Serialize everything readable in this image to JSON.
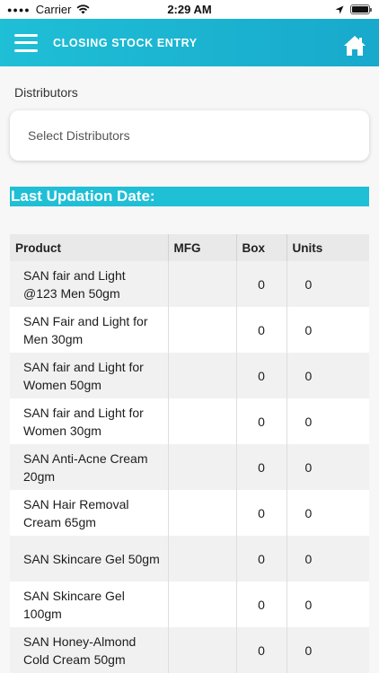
{
  "status_bar": {
    "carrier": "Carrier",
    "time": "2:29 AM",
    "icons": [
      "wifi-icon",
      "location-arrow-icon",
      "battery-icon"
    ]
  },
  "header": {
    "title": "CLOSING STOCK ENTRY",
    "menu_icon": "hamburger-menu-icon",
    "home_icon": "home-icon",
    "accent_color": "#1fbfd6"
  },
  "distributors": {
    "label": "Distributors",
    "placeholder": "Select Distributors"
  },
  "last_updation": {
    "label": "Last Updation Date:"
  },
  "table": {
    "columns": [
      "Product",
      "MFG",
      "Box",
      "Units"
    ],
    "rows": [
      {
        "product": "SAN fair and Light @123 Men 50gm",
        "mfg": "",
        "box": "0",
        "units": "0"
      },
      {
        "product": "SAN Fair and Light for Men 30gm",
        "mfg": "",
        "box": "0",
        "units": "0"
      },
      {
        "product": "SAN fair and Light for Women 50gm",
        "mfg": "",
        "box": "0",
        "units": "0"
      },
      {
        "product": "SAN fair and Light for Women 30gm",
        "mfg": "",
        "box": "0",
        "units": "0"
      },
      {
        "product": "SAN Anti-Acne Cream 20gm",
        "mfg": "",
        "box": "0",
        "units": "0"
      },
      {
        "product": "SAN Hair Removal Cream 65gm",
        "mfg": "",
        "box": "0",
        "units": "0"
      },
      {
        "product": "SAN Skincare Gel 50gm",
        "mfg": "",
        "box": "0",
        "units": "0"
      },
      {
        "product": "SAN Skincare Gel 100gm",
        "mfg": "",
        "box": "0",
        "units": "0"
      },
      {
        "product": "SAN Honey-Almond Cold Cream 50gm",
        "mfg": "",
        "box": "0",
        "units": "0"
      }
    ]
  }
}
